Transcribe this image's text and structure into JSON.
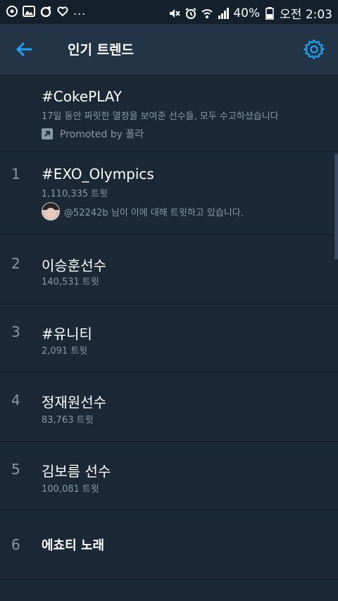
{
  "statusbar": {
    "battery": "40%",
    "time": "오전 2:03",
    "more": "..."
  },
  "appbar": {
    "title": "인기 트렌드"
  },
  "promoted": {
    "topic": "#CokePLAY",
    "description": "17일 동안 짜릿한 열정을 보여준 선수들, 모두 수고하셨습니다",
    "promoted_by": "Promoted by 폴라"
  },
  "trends": [
    {
      "rank": "1",
      "topic": "#EXO_Olympics",
      "count": "1,110,335 트윗",
      "tweeter": "@52242b 님이 이에 대해 트윗하고 있습니다."
    },
    {
      "rank": "2",
      "topic": "이승훈선수",
      "count": "140,531 트윗"
    },
    {
      "rank": "3",
      "topic": "#유니티",
      "count": "2,091 트윗"
    },
    {
      "rank": "4",
      "topic": "정재원선수",
      "count": "83,763 트윗"
    },
    {
      "rank": "5",
      "topic": "김보름 선수",
      "count": "100,081 트윗"
    },
    {
      "rank": "6",
      "topic": "에쵸티 노래"
    }
  ],
  "colors": {
    "background": "#1b2836",
    "appbar": "#243447",
    "accent": "#1da1f2",
    "secondary_text": "#8899a6"
  }
}
